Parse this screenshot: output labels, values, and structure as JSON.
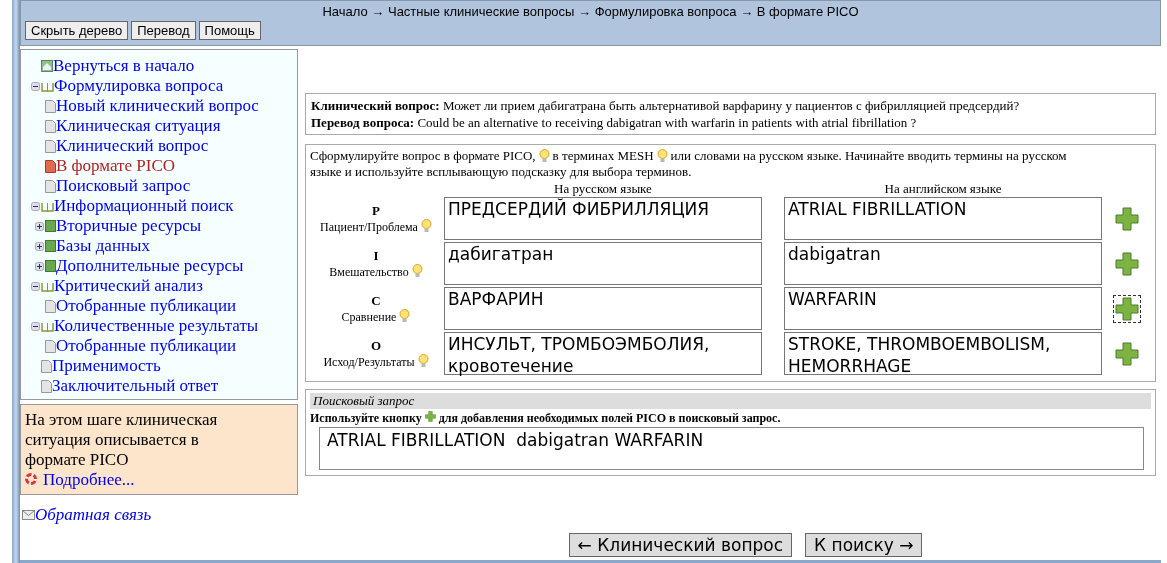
{
  "breadcrumb": "Начало → Частные клинические вопросы → Формулировка вопроса → В формате PICO",
  "toolbar": [
    "Скрыть дерево",
    "Перевод",
    "Помощь"
  ],
  "tree": [
    {
      "label": "Вернуться в начало",
      "kind": "home",
      "selected": false
    },
    {
      "label": "Формулировка вопроса",
      "kind": "folder",
      "expanded": true,
      "selected": false,
      "children": [
        {
          "label": "Новый клинический вопрос",
          "kind": "page",
          "selected": false
        },
        {
          "label": "Клиническая ситуация",
          "kind": "page",
          "selected": false
        },
        {
          "label": "Клинический вопрос",
          "kind": "page",
          "selected": false
        },
        {
          "label": "В формате PICO",
          "kind": "page",
          "selected": true
        },
        {
          "label": "Поисковый запрос",
          "kind": "page",
          "selected": false
        }
      ]
    },
    {
      "label": "Информационный поиск",
      "kind": "folder",
      "expanded": true,
      "selected": false,
      "children": [
        {
          "label": "Вторичные ресурсы",
          "kind": "book",
          "expanded": false,
          "selected": false
        },
        {
          "label": "Базы данных",
          "kind": "book",
          "expanded": false,
          "selected": false
        },
        {
          "label": "Дополнительные ресурсы",
          "kind": "book",
          "expanded": false,
          "selected": false
        }
      ]
    },
    {
      "label": "Критический анализ",
      "kind": "folder",
      "expanded": true,
      "selected": false,
      "children": [
        {
          "label": "Отобранные публикации",
          "kind": "page",
          "selected": false
        }
      ]
    },
    {
      "label": "Количественные результаты",
      "kind": "folder",
      "expanded": true,
      "selected": false,
      "children": [
        {
          "label": "Отобранные публикации",
          "kind": "page",
          "selected": false
        }
      ]
    },
    {
      "label": "Применимость",
      "kind": "page",
      "selected": false
    },
    {
      "label": "Заключительный ответ",
      "kind": "page",
      "selected": false
    }
  ],
  "info": {
    "text": "На этом шаге клиническая ситуация описывается в формате PICO",
    "link": "Подробнее..."
  },
  "feedback": "Обратная связь",
  "question": [
    "**Клинический вопрос:** Может ли прием дабигатрана быть альтернативой варфарину у пациентов с фибрилляцией предсердий?",
    "**Перевод вопроса:** Could be an alternative to receiving dabigatran with warfarin in patients with atrial fibrillation ?"
  ],
  "pico": {
    "instruction": [
      "Сформулируйте вопрос в формате PICO,",
      "в терминах MESH",
      "или словами на русском языке. Начинайте вводить термины на русском",
      "языке и используйте всплывающую подсказку для выбора терминов."
    ],
    "columns": [
      "На русском языке",
      "На английском языке"
    ],
    "rows": [
      {
        "letter": "P",
        "name": "Пациент/Проблема",
        "ru": "ПРЕДСЕРДИЙ ФИБРИЛЛЯЦИЯ",
        "en": "ATRIAL FIBRILLATION",
        "focused": false
      },
      {
        "letter": "I",
        "name": "Вмешательство",
        "ru": "дабигатран",
        "en": "dabigatran",
        "focused": false
      },
      {
        "letter": "C",
        "name": "Сравнение",
        "ru": "ВАРФАРИН",
        "en": "WARFARIN",
        "focused": true
      },
      {
        "letter": "O",
        "name": "Исход/Результаты",
        "ru": "ИНСУЛЬТ, ТРОМБОЭМБОЛИЯ, кровотечение",
        "en": "STROKE, THROMBOEMBOLISM, HEMORRHAGE",
        "focused": false
      }
    ]
  },
  "search": {
    "title": "Поисковый запрос",
    "hint_before": "Используйте кнопку",
    "hint_after": "для добавления необходимых полей PICO в поисковый запрос.",
    "value": "ATRIAL FIBRILLATION  dabigatran WARFARIN"
  },
  "nav": [
    "← Клинический вопрос",
    "К поиску →"
  ]
}
